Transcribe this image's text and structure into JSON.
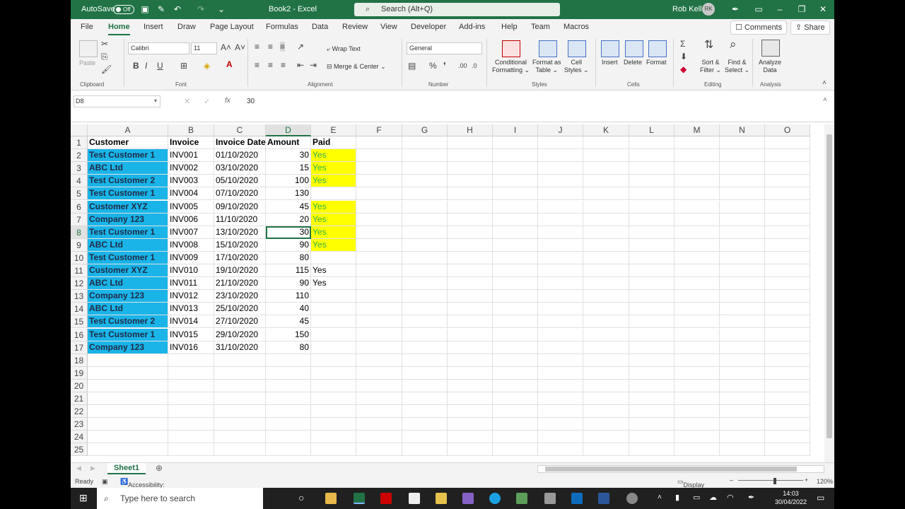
{
  "titlebar": {
    "autosave": "AutoSave",
    "toggle": "Off",
    "doc": "Book2",
    "sep": "-",
    "app": "Excel",
    "search": "Search (Alt+Q)",
    "user": "Rob Kell",
    "initials": "RK"
  },
  "tabs": [
    "File",
    "Home",
    "Insert",
    "Draw",
    "Page Layout",
    "Formulas",
    "Data",
    "Review",
    "View",
    "Developer",
    "Add-ins",
    "Help",
    "Team",
    "Macros"
  ],
  "buttons": {
    "comments": "Comments",
    "share": "Share"
  },
  "ribbon": {
    "clipboard": {
      "paste": "Paste",
      "label": "Clipboard"
    },
    "font": {
      "name": "Calibri",
      "size": "11",
      "label": "Font",
      "bold": "B",
      "italic": "I",
      "underline": "U"
    },
    "alignment": {
      "wrap": "Wrap Text",
      "merge": "Merge & Center",
      "label": "Alignment"
    },
    "number": {
      "format": "General",
      "label": "Number"
    },
    "styles": {
      "cond1": "Conditional",
      "cond2": "Formatting",
      "fat1": "Format as",
      "fat2": "Table",
      "cell1": "Cell",
      "cell2": "Styles",
      "label": "Styles"
    },
    "cells": {
      "insert": "Insert",
      "delete": "Delete",
      "format": "Format",
      "label": "Cells"
    },
    "editing": {
      "sort1": "Sort &",
      "sort2": "Filter",
      "find1": "Find &",
      "find2": "Select",
      "label": "Editing"
    },
    "analysis": {
      "a1": "Analyze",
      "a2": "Data",
      "label": "Analysis"
    }
  },
  "formula_bar": {
    "name_box": "D8",
    "fx": "fx",
    "value": "30"
  },
  "columns": [
    "A",
    "B",
    "C",
    "D",
    "E",
    "F",
    "G",
    "H",
    "I",
    "J",
    "K",
    "L",
    "M",
    "N",
    "O"
  ],
  "rows": [
    "1",
    "2",
    "3",
    "4",
    "5",
    "6",
    "7",
    "8",
    "9",
    "10",
    "11",
    "12",
    "13",
    "14",
    "15",
    "16",
    "17",
    "18",
    "19",
    "20",
    "21",
    "22",
    "23",
    "24",
    "25"
  ],
  "headers": [
    "Customer",
    "Invoice",
    "Invoice Date",
    "Amount",
    "Paid"
  ],
  "data": [
    [
      "Test Customer 1",
      "INV001",
      "01/10/2020",
      "30",
      "Yes"
    ],
    [
      "ABC Ltd",
      "INV002",
      "03/10/2020",
      "15",
      "Yes"
    ],
    [
      "Test Customer 2",
      "INV003",
      "05/10/2020",
      "100",
      "Yes"
    ],
    [
      "Test Customer 1",
      "INV004",
      "07/10/2020",
      "130",
      ""
    ],
    [
      "Customer XYZ",
      "INV005",
      "09/10/2020",
      "45",
      "Yes"
    ],
    [
      "Company 123",
      "INV006",
      "11/10/2020",
      "20",
      "Yes"
    ],
    [
      "Test Customer 1",
      "INV007",
      "13/10/2020",
      "30",
      "Yes"
    ],
    [
      "ABC Ltd",
      "INV008",
      "15/10/2020",
      "90",
      "Yes"
    ],
    [
      "Test Customer 1",
      "INV009",
      "17/10/2020",
      "80",
      ""
    ],
    [
      "Customer XYZ",
      "INV010",
      "19/10/2020",
      "115",
      "Yes"
    ],
    [
      "ABC Ltd",
      "INV011",
      "21/10/2020",
      "90",
      "Yes"
    ],
    [
      "Company 123",
      "INV012",
      "23/10/2020",
      "110",
      ""
    ],
    [
      "ABC Ltd",
      "INV013",
      "25/10/2020",
      "40",
      ""
    ],
    [
      "Test Customer 2",
      "INV014",
      "27/10/2020",
      "45",
      ""
    ],
    [
      "Test Customer 1",
      "INV015",
      "29/10/2020",
      "150",
      ""
    ],
    [
      "Company 123",
      "INV016",
      "31/10/2020",
      "80",
      ""
    ]
  ],
  "highlighted_paid_rows": [
    2,
    3,
    4,
    6,
    7,
    8,
    9
  ],
  "sheet_tab": "Sheet1",
  "status": {
    "ready": "Ready",
    "accessibility": "Accessibility: Investigate",
    "display": "Display Settings",
    "zoom": "120%"
  },
  "taskbar": {
    "search": "Type here to search",
    "time": "14:03",
    "date": "30/04/2022"
  },
  "colors": {
    "excel_green": "#217346",
    "customer_fill": "#1ab4e8",
    "paid_fill": "#ffff00",
    "paid_text": "#2fb24a"
  }
}
